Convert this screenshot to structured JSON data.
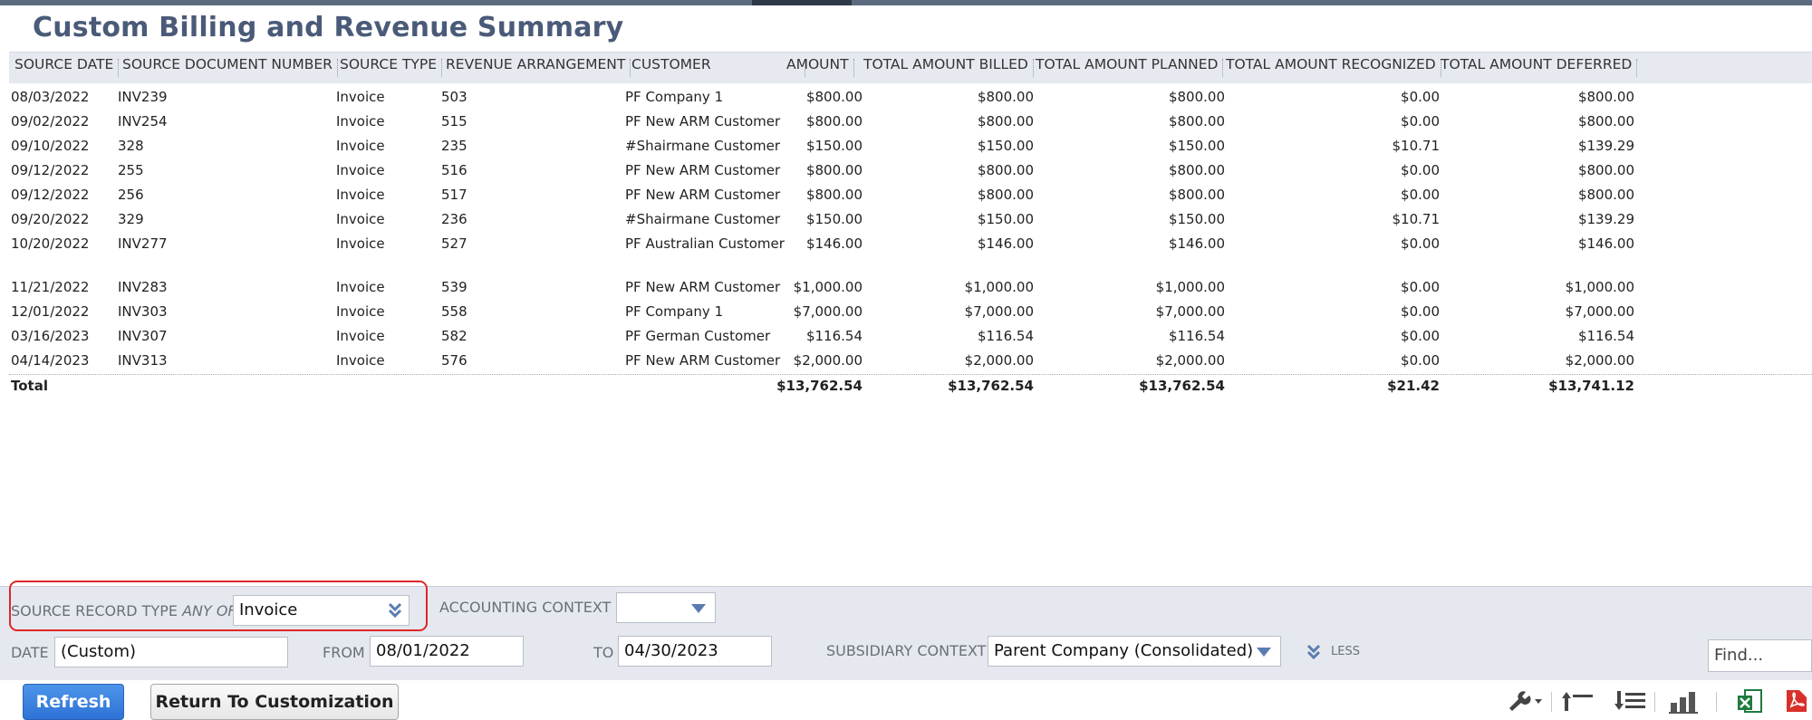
{
  "page": {
    "title": "Custom Billing and Revenue Summary"
  },
  "columns": [
    {
      "key": "source_date",
      "label": "SOURCE DATE"
    },
    {
      "key": "source_document_number",
      "label": "SOURCE DOCUMENT NUMBER"
    },
    {
      "key": "source_type",
      "label": "SOURCE TYPE"
    },
    {
      "key": "revenue_arrangement",
      "label": "REVENUE ARRANGEMENT"
    },
    {
      "key": "customer",
      "label": "CUSTOMER"
    },
    {
      "key": "amount",
      "label": "AMOUNT"
    },
    {
      "key": "total_amount_billed",
      "label": "TOTAL AMOUNT BILLED"
    },
    {
      "key": "total_amount_planned",
      "label": "TOTAL AMOUNT PLANNED"
    },
    {
      "key": "total_amount_recognized",
      "label": "TOTAL AMOUNT RECOGNIZED"
    },
    {
      "key": "total_amount_deferred",
      "label": "TOTAL AMOUNT DEFERRED"
    }
  ],
  "rows": [
    [
      "08/03/2022",
      "INV239",
      "Invoice",
      "503",
      "PF Company 1",
      "$800.00",
      "$800.00",
      "$800.00",
      "$0.00",
      "$800.00"
    ],
    [
      "09/02/2022",
      "INV254",
      "Invoice",
      "515",
      "PF New ARM Customer",
      "$800.00",
      "$800.00",
      "$800.00",
      "$0.00",
      "$800.00"
    ],
    [
      "09/10/2022",
      "328",
      "Invoice",
      "235",
      "#Shairmane Customer",
      "$150.00",
      "$150.00",
      "$150.00",
      "$10.71",
      "$139.29"
    ],
    [
      "09/12/2022",
      "255",
      "Invoice",
      "516",
      "PF New ARM Customer",
      "$800.00",
      "$800.00",
      "$800.00",
      "$0.00",
      "$800.00"
    ],
    [
      "09/12/2022",
      "256",
      "Invoice",
      "517",
      "PF New ARM Customer",
      "$800.00",
      "$800.00",
      "$800.00",
      "$0.00",
      "$800.00"
    ],
    [
      "09/20/2022",
      "329",
      "Invoice",
      "236",
      "#Shairmane Customer",
      "$150.00",
      "$150.00",
      "$150.00",
      "$10.71",
      "$139.29"
    ],
    [
      "10/20/2022",
      "INV277",
      "Invoice",
      "527",
      "PF Australian Customer",
      "$146.00",
      "$146.00",
      "$146.00",
      "$0.00",
      "$146.00"
    ],
    [
      "11/21/2022",
      "INV283",
      "Invoice",
      "539",
      "PF New ARM Customer",
      "$1,000.00",
      "$1,000.00",
      "$1,000.00",
      "$0.00",
      "$1,000.00"
    ],
    [
      "12/01/2022",
      "INV303",
      "Invoice",
      "558",
      "PF Company 1",
      "$7,000.00",
      "$7,000.00",
      "$7,000.00",
      "$0.00",
      "$7,000.00"
    ],
    [
      "03/16/2023",
      "INV307",
      "Invoice",
      "582",
      "PF German Customer",
      "$116.54",
      "$116.54",
      "$116.54",
      "$0.00",
      "$116.54"
    ],
    [
      "04/14/2023",
      "INV313",
      "Invoice",
      "576",
      "PF New ARM Customer",
      "$2,000.00",
      "$2,000.00",
      "$2,000.00",
      "$0.00",
      "$2,000.00"
    ]
  ],
  "total": {
    "label": "Total",
    "amount": "$13,762.54",
    "billed": "$13,762.54",
    "planned": "$13,762.54",
    "recognized": "$21.42",
    "deferred": "$13,741.12"
  },
  "filters": {
    "source_record_type": {
      "label": "SOURCE RECORD TYPE",
      "qualifier": "ANY OF",
      "value": "Invoice"
    },
    "accounting_context": {
      "label": "ACCOUNTING CONTEXT",
      "value": ""
    },
    "date": {
      "label": "DATE",
      "value": "(Custom)"
    },
    "from": {
      "label": "FROM",
      "value": "08/01/2022"
    },
    "to": {
      "label": "TO",
      "value": "04/30/2023"
    },
    "subsidiary_context": {
      "label": "SUBSIDIARY CONTEXT",
      "value": "Parent Company (Consolidated)"
    },
    "less_label": "LESS"
  },
  "actions": {
    "refresh": "Refresh",
    "return": "Return To Customization",
    "find_placeholder": "Find..."
  },
  "toolbar_icons": [
    "wrench-icon",
    "collapse-all-icon",
    "expand-all-icon",
    "chart-icon",
    "excel-export-icon",
    "pdf-export-icon"
  ],
  "colors": {
    "accent": "#2e72d6",
    "highlight": "#e0262a",
    "title": "#4a5a78",
    "header_bg": "#e6eaf0",
    "filter_bg": "#e5e9ef"
  }
}
